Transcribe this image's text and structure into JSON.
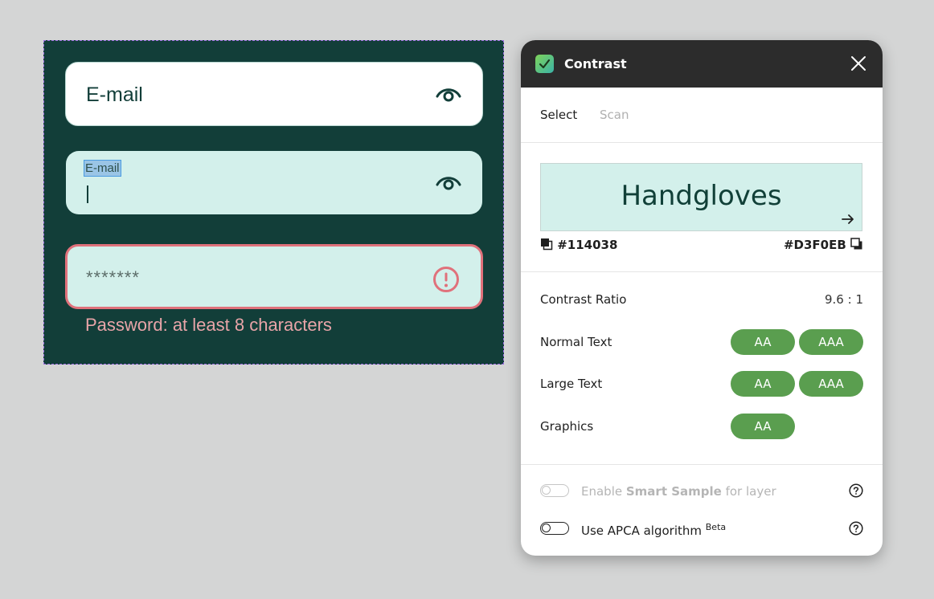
{
  "artboard": {
    "email_field": {
      "value": "E-mail",
      "icon": "eye-icon"
    },
    "focused_field": {
      "label": "E-mail",
      "icon": "eye-icon"
    },
    "password_field": {
      "value": "*******",
      "icon": "alert-circle-icon",
      "error_color": "#e0717b"
    },
    "helper_text": "Password: at least 8 characters"
  },
  "panel": {
    "title": "Contrast",
    "tabs": [
      {
        "label": "Select",
        "selected": true
      },
      {
        "label": "Scan",
        "selected": false
      }
    ],
    "preview": {
      "sample_text": "Handgloves",
      "foreground": "#114038",
      "background": "#D3F0EB"
    },
    "foreground_label": "#114038",
    "background_label": "#D3F0EB",
    "contrast": {
      "label": "Contrast Ratio",
      "value": "9.6 : 1"
    },
    "results": [
      {
        "label": "Normal Text",
        "badges": [
          "AA",
          "AAA"
        ]
      },
      {
        "label": "Large Text",
        "badges": [
          "AA",
          "AAA"
        ]
      },
      {
        "label": "Graphics",
        "badges": [
          "AA"
        ]
      }
    ],
    "badge_color": "#5a9e4f",
    "options": {
      "smart_sample": {
        "prefix": "Enable ",
        "bold": "Smart Sample",
        "suffix": " for layer",
        "enabled": false,
        "disabled": true
      },
      "apca": {
        "label": "Use APCA algorithm ",
        "sup": "Beta",
        "enabled": false
      }
    }
  }
}
